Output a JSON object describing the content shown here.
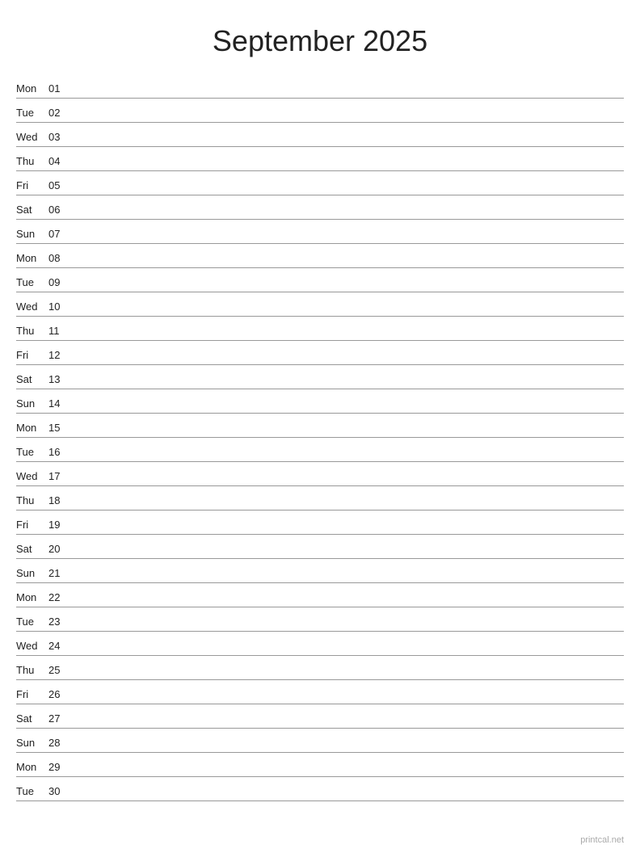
{
  "title": "September 2025",
  "watermark": "printcal.net",
  "days": [
    {
      "name": "Mon",
      "number": "01"
    },
    {
      "name": "Tue",
      "number": "02"
    },
    {
      "name": "Wed",
      "number": "03"
    },
    {
      "name": "Thu",
      "number": "04"
    },
    {
      "name": "Fri",
      "number": "05"
    },
    {
      "name": "Sat",
      "number": "06"
    },
    {
      "name": "Sun",
      "number": "07"
    },
    {
      "name": "Mon",
      "number": "08"
    },
    {
      "name": "Tue",
      "number": "09"
    },
    {
      "name": "Wed",
      "number": "10"
    },
    {
      "name": "Thu",
      "number": "11"
    },
    {
      "name": "Fri",
      "number": "12"
    },
    {
      "name": "Sat",
      "number": "13"
    },
    {
      "name": "Sun",
      "number": "14"
    },
    {
      "name": "Mon",
      "number": "15"
    },
    {
      "name": "Tue",
      "number": "16"
    },
    {
      "name": "Wed",
      "number": "17"
    },
    {
      "name": "Thu",
      "number": "18"
    },
    {
      "name": "Fri",
      "number": "19"
    },
    {
      "name": "Sat",
      "number": "20"
    },
    {
      "name": "Sun",
      "number": "21"
    },
    {
      "name": "Mon",
      "number": "22"
    },
    {
      "name": "Tue",
      "number": "23"
    },
    {
      "name": "Wed",
      "number": "24"
    },
    {
      "name": "Thu",
      "number": "25"
    },
    {
      "name": "Fri",
      "number": "26"
    },
    {
      "name": "Sat",
      "number": "27"
    },
    {
      "name": "Sun",
      "number": "28"
    },
    {
      "name": "Mon",
      "number": "29"
    },
    {
      "name": "Tue",
      "number": "30"
    }
  ]
}
